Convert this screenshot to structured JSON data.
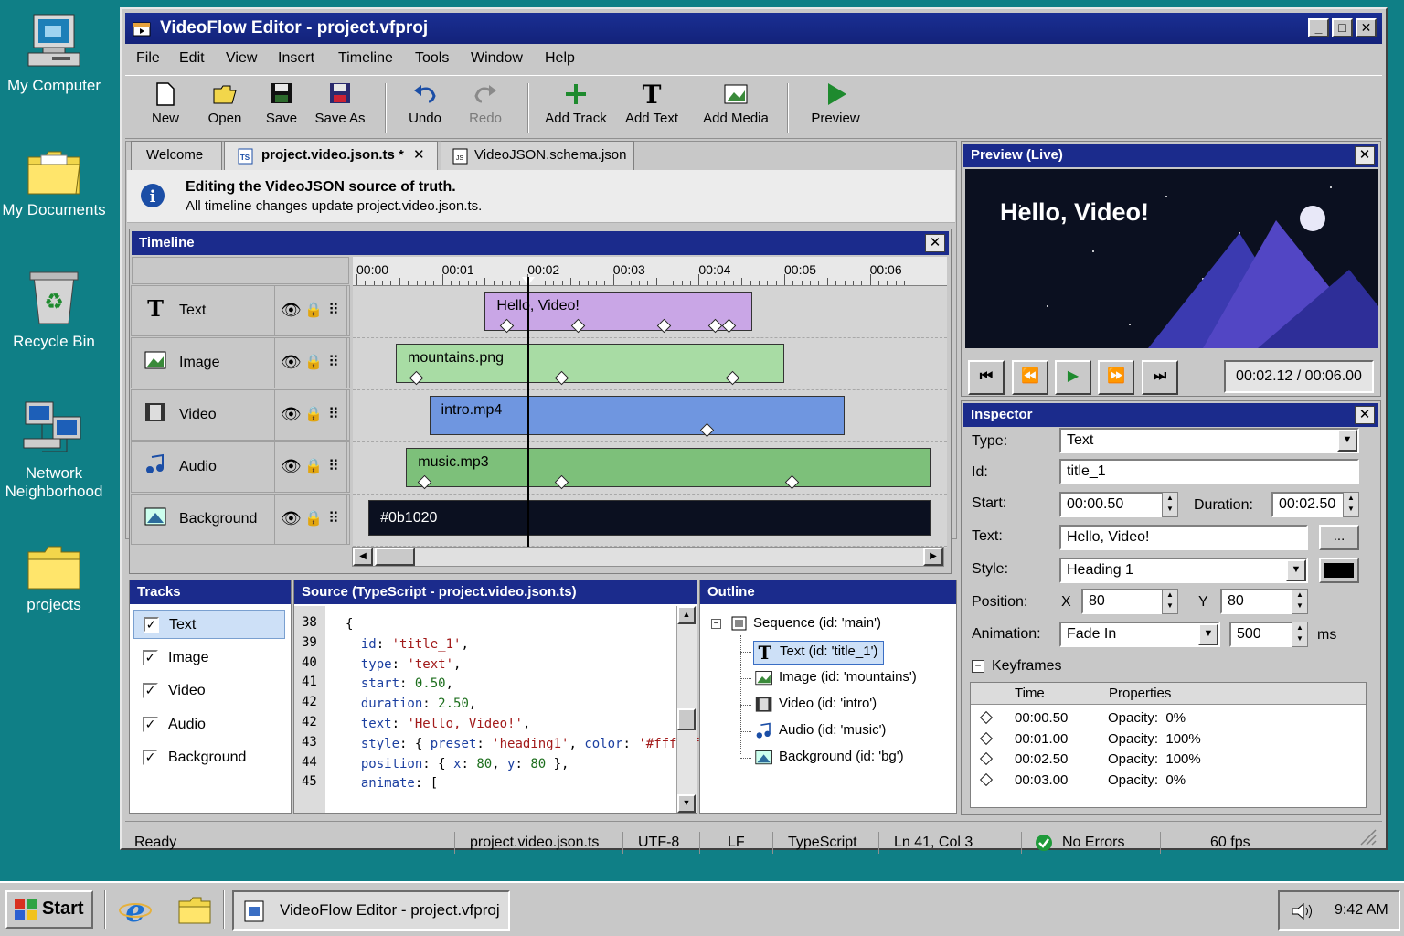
{
  "desktop": {
    "icons": [
      {
        "label": "My Computer"
      },
      {
        "label": "My Documents"
      },
      {
        "label": "Recycle Bin"
      },
      {
        "label": "Network Neighborhood"
      },
      {
        "label": "projects"
      }
    ]
  },
  "window": {
    "title": "VideoFlow Editor - project.vfproj",
    "menu": [
      "File",
      "Edit",
      "View",
      "Insert",
      "Timeline",
      "Tools",
      "Window",
      "Help"
    ],
    "toolbar": [
      "New",
      "Open",
      "Save",
      "Save As",
      "Undo",
      "Redo",
      "Add Track",
      "Add Text",
      "Add Media",
      "Preview"
    ],
    "tabs": {
      "welcome": "Welcome",
      "active": "project.video.json.ts *",
      "schema": "VideoJSON.schema.json"
    },
    "info": {
      "title": "Editing the VideoJSON source of truth.",
      "sub": "All timeline changes update project.video.json.ts."
    }
  },
  "timeline": {
    "title": "Timeline",
    "ticks": [
      "00:00",
      "00:01",
      "00:02",
      "00:03",
      "00:04",
      "00:05",
      "00:06"
    ],
    "playhead": 2.0,
    "tracks": [
      "Text",
      "Image",
      "Video",
      "Audio",
      "Background"
    ],
    "clips": {
      "text": "Hello, Video!",
      "image": "mountains.png",
      "video": "intro.mp4",
      "audio": "music.mp3",
      "bg": "#0b1020"
    }
  },
  "preview": {
    "title": "Preview (Live)",
    "text": "Hello, Video!",
    "time": "00:02.12 / 00:06.00"
  },
  "inspector": {
    "title": "Inspector",
    "type_label": "Type:",
    "type": "Text",
    "id_label": "Id:",
    "id": "title_1",
    "start_label": "Start:",
    "start": "00:00.50",
    "duration_label": "Duration:",
    "duration": "00:02.50",
    "text_label": "Text:",
    "text": "Hello, Video!",
    "ellipsis": "...",
    "style_label": "Style:",
    "style": "Heading 1",
    "position_label": "Position:",
    "x_label": "X",
    "x": "80",
    "y_label": "Y",
    "y": "80",
    "animation_label": "Animation:",
    "animation": "Fade In",
    "anim_ms": "500",
    "ms": "ms",
    "keyframes_label": "Keyframes",
    "kf_headers": [
      "Time",
      "Properties"
    ],
    "keyframes": [
      {
        "time": "00:00.50",
        "prop": "Opacity:  0%"
      },
      {
        "time": "00:01.00",
        "prop": "Opacity:  100%"
      },
      {
        "time": "00:02.50",
        "prop": "Opacity:  100%"
      },
      {
        "time": "00:03.00",
        "prop": "Opacity:  0%"
      }
    ],
    "color_swatch": "#000000"
  },
  "tracks_panel": {
    "title": "Tracks",
    "items": [
      "Text",
      "Image",
      "Video",
      "Audio",
      "Background"
    ]
  },
  "source": {
    "title": "Source (TypeScript - project.video.json.ts)",
    "line_numbers": [
      "38",
      "39",
      "40",
      "41",
      "42",
      "42",
      "43",
      "44",
      "45"
    ]
  },
  "outline": {
    "title": "Outline",
    "root": "Sequence (id: 'main')",
    "items": [
      "Text (id: 'title_1')",
      "Image (id: 'mountains')",
      "Video (id: 'intro')",
      "Audio (id: 'music')",
      "Background (id: 'bg')"
    ]
  },
  "statusbar": {
    "ready": "Ready",
    "file": "project.video.json.ts",
    "enc": "UTF-8",
    "eol": "LF",
    "lang": "TypeScript",
    "pos": "Ln 41, Col 3",
    "errors": "No Errors",
    "fps": "60 fps"
  },
  "taskbar": {
    "start": "Start",
    "task": "VideoFlow Editor - project.vfproj",
    "clock": "9:42 AM"
  }
}
